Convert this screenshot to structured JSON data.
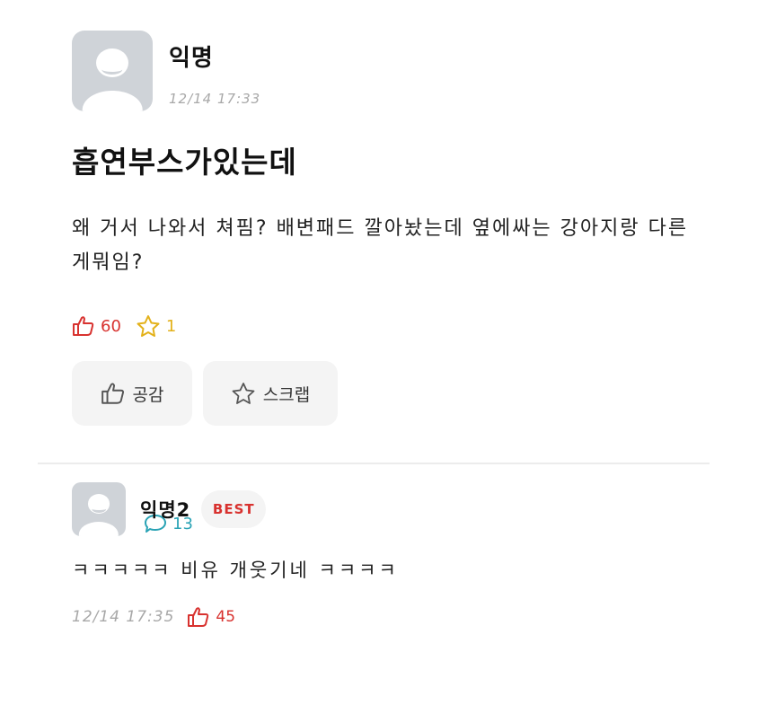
{
  "post": {
    "author": "익명",
    "time": "12/14 17:33",
    "title": "흡연부스가있는데",
    "body": "왜 거서 나와서 쳐핌? 배변패드 깔아놨는데 옆에싸는 강아지랑 다른게뭐임?",
    "stats": {
      "likes": "60",
      "comments": "13",
      "scraps": "1"
    },
    "actions": {
      "like_label": "공감",
      "scrap_label": "스크랩"
    }
  },
  "comment": {
    "author": "익명2",
    "badge": "BEST",
    "text": "ㅋㅋㅋㅋㅋ 비유 개웃기네 ㅋㅋㅋㅋ",
    "time": "12/14 17:35",
    "likes": "45"
  },
  "colors": {
    "like": "#d8322f",
    "comment": "#2aa3b5",
    "scrap": "#e3b11a",
    "avatar_bg": "#cfd3d8"
  },
  "icons": [
    "thumbs-up-icon",
    "speech-bubble-icon",
    "star-icon",
    "default-avatar-icon"
  ]
}
